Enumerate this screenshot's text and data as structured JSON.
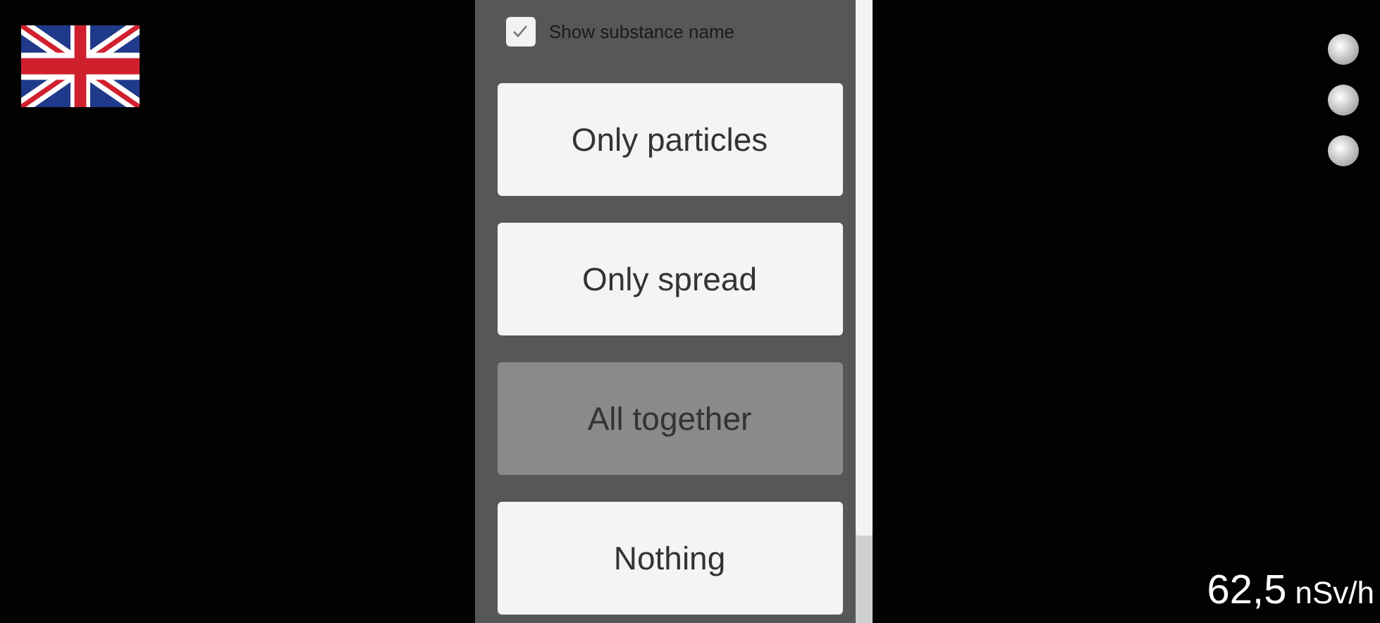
{
  "checkbox": {
    "label": "Show substance name",
    "checked": true
  },
  "options": [
    {
      "label": "Only particles",
      "selected": false
    },
    {
      "label": "Only spread",
      "selected": false
    },
    {
      "label": "All together",
      "selected": true
    },
    {
      "label": "Nothing",
      "selected": false
    }
  ],
  "reading": {
    "value": "62,5",
    "unit": "nSv/h"
  }
}
